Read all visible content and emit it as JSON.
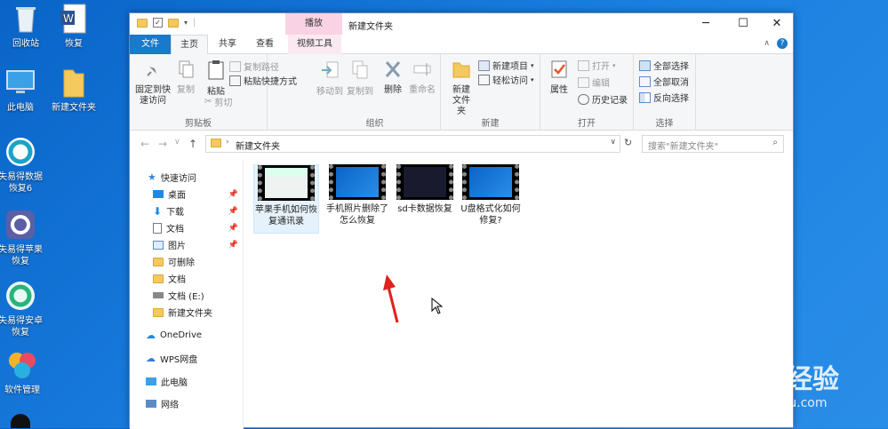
{
  "desktop": {
    "icons": [
      {
        "label": "回收站",
        "icon": "recycle-bin-icon"
      },
      {
        "label": "恢复",
        "icon": "word-doc-icon"
      },
      {
        "label": "此电脑",
        "icon": "computer-icon"
      },
      {
        "label": "新建文件夹",
        "icon": "folder-icon"
      },
      {
        "label": "失易得数据恢复6",
        "icon": "recovery-app-icon"
      },
      {
        "label": "失易得苹果恢复",
        "icon": "apple-recovery-icon"
      },
      {
        "label": "失易得安卓恢复",
        "icon": "android-recovery-icon"
      },
      {
        "label": "软件管理",
        "icon": "software-manager-icon"
      }
    ]
  },
  "window": {
    "title": "新建文件夹",
    "context_tab": "播放",
    "controls": {
      "minimize": "─",
      "maximize": "☐",
      "close": "✕"
    }
  },
  "tabs": {
    "file": "文件",
    "home": "主页",
    "share": "共享",
    "view": "查看",
    "video_tools": "视频工具"
  },
  "ribbon": {
    "clipboard": {
      "label": "剪贴板",
      "pin": "固定到快速访问",
      "copy": "复制",
      "paste": "粘贴",
      "cut": "剪切",
      "copy_path": "复制路径",
      "paste_shortcut": "粘贴快捷方式"
    },
    "organize": {
      "label": "组织",
      "move_to": "移动到",
      "copy_to": "复制到",
      "delete": "删除",
      "rename": "重命名"
    },
    "new": {
      "label": "新建",
      "new_folder": "新建文件夹",
      "new_item": "新建项目",
      "easy_access": "轻松访问"
    },
    "open": {
      "label": "打开",
      "properties": "属性",
      "open": "打开",
      "edit": "编辑",
      "history": "历史记录"
    },
    "select": {
      "label": "选择",
      "select_all": "全部选择",
      "select_none": "全部取消",
      "invert": "反向选择"
    }
  },
  "address": {
    "path": "新建文件夹",
    "search_placeholder": "搜索\"新建文件夹\""
  },
  "nav": {
    "quick_access": "快速访问",
    "items": [
      "桌面",
      "下载",
      "文档",
      "图片",
      "可删除",
      "文档",
      "文档 (E:)",
      "新建文件夹"
    ],
    "onedrive": "OneDrive",
    "wps": "WPS网盘",
    "this_pc": "此电脑",
    "network": "网络"
  },
  "files": [
    {
      "name": "苹果手机如何恢复通讯录"
    },
    {
      "name": "手机照片删除了怎么恢复"
    },
    {
      "name": "sd卡数据恢复"
    },
    {
      "name": "U盘格式化如何修复?"
    }
  ],
  "watermark": {
    "brand": "Baidu经验",
    "url": "jingyan.baidu.com"
  },
  "colors": {
    "accent": "#1979ca",
    "ribbon_bg": "#f5f6f7",
    "context_tab": "#f9d3e3",
    "arrow": "#e0201b"
  }
}
